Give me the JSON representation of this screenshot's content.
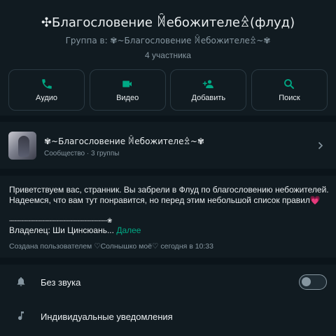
{
  "header": {
    "title": "✣Благословение ꁑебожителеꊛ(флуд)",
    "subtitle": "Группа в: ✾~Благословение ꁑебожителеꊛ~✾",
    "members": "4 участника"
  },
  "actions": [
    {
      "label": "Аудио",
      "icon": "phone-icon"
    },
    {
      "label": "Видео",
      "icon": "video-icon"
    },
    {
      "label": "Добавить",
      "icon": "add-person-icon"
    },
    {
      "label": "Поиск",
      "icon": "search-icon"
    }
  ],
  "community": {
    "name": "✾~Благословение ꁑебожителеꊛ~✾",
    "meta": "Сообщество · 3 группы"
  },
  "description": {
    "text": "Приветствуем вас, странник. Вы забрели в Флуд по благословению небожителей. Надеемся, что вам тут понравится, но перед этим небольшой список правил",
    "heart": "💗",
    "divider": "--------------------------------------------------------❀",
    "owner": "Владелец: Ши Цинсюань...",
    "more": "Далее",
    "created": "Создана пользователем ♡Солнышко моё♡ сегодня в 10:33"
  },
  "settings": {
    "mute_label": "Без звука",
    "mute_enabled": false,
    "notifications_label": "Индивидуальные уведомления"
  },
  "colors": {
    "accent": "#00a884",
    "background": "#0b141a",
    "panel": "#111b21",
    "secondary_text": "#8696a0"
  }
}
